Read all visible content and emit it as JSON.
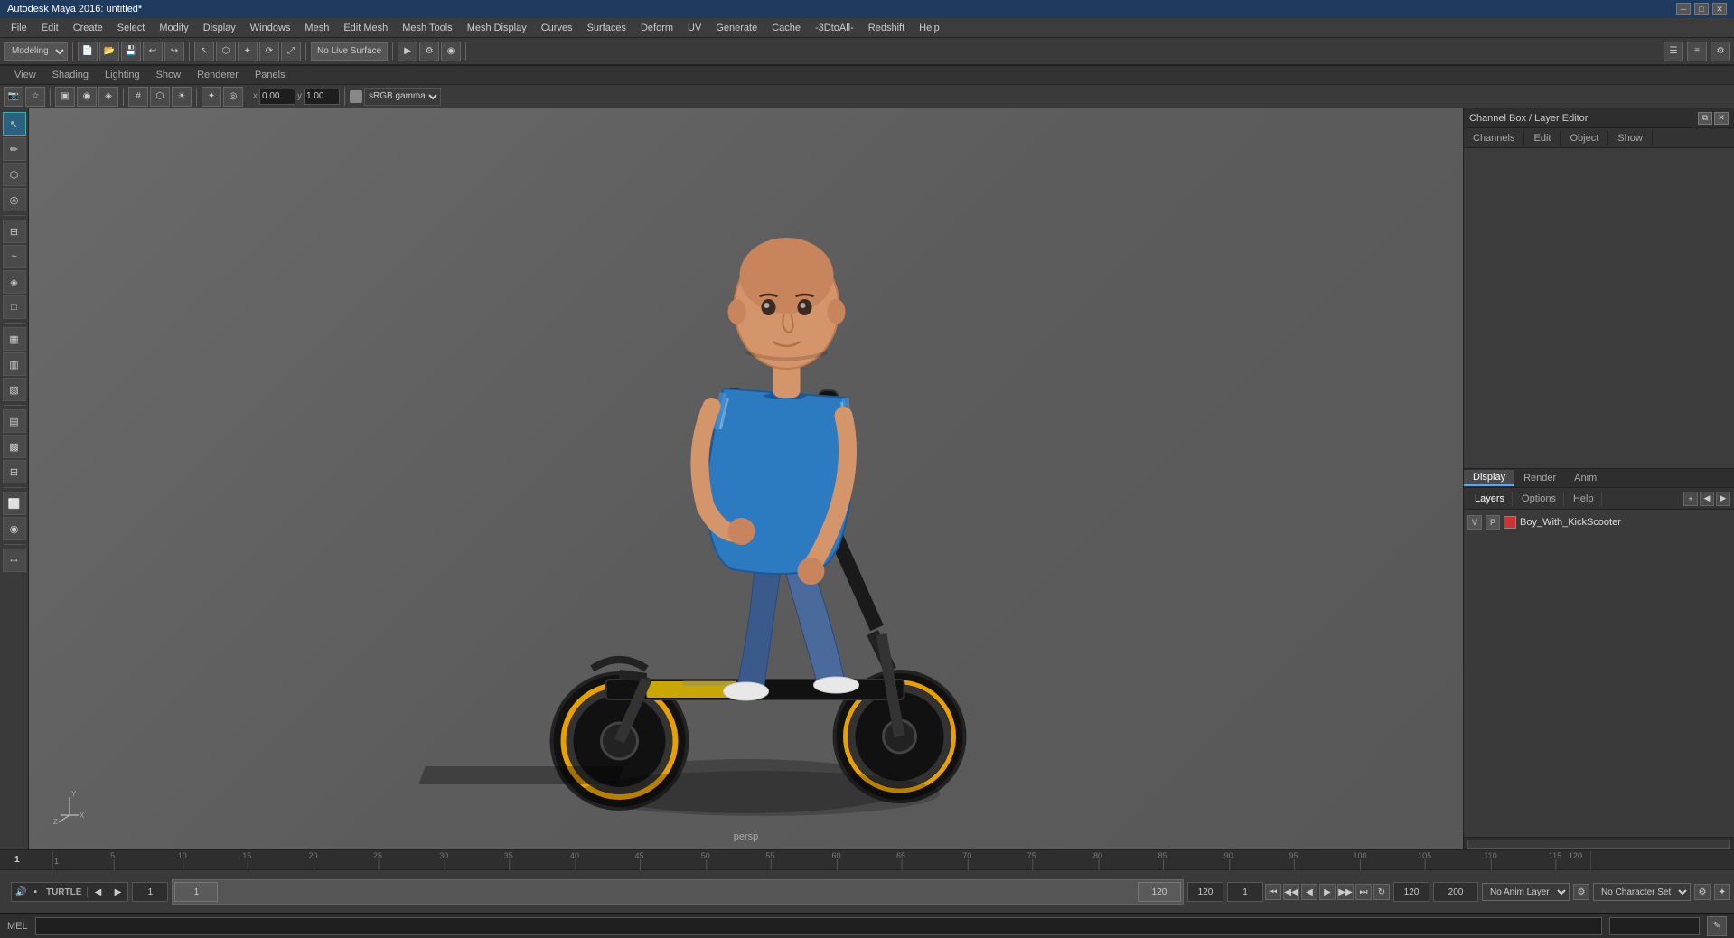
{
  "app": {
    "title": "Autodesk Maya 2016: untitled*",
    "win_buttons": [
      "─",
      "□",
      "✕"
    ]
  },
  "menu_bar": {
    "items": [
      "File",
      "Edit",
      "Create",
      "Select",
      "Modify",
      "Display",
      "Windows",
      "Mesh",
      "Edit Mesh",
      "Mesh Tools",
      "Mesh Display",
      "Curves",
      "Surfaces",
      "Deform",
      "UV",
      "Generate",
      "Cache",
      "-3DtoAll-",
      "Redshift",
      "Help"
    ]
  },
  "toolbar1": {
    "mode_label": "Modeling",
    "no_live_surface": "No Live Surface",
    "gamma_label": "sRGB gamma"
  },
  "viewport_submenu": {
    "items": [
      "View",
      "Shading",
      "Lighting",
      "Show",
      "Renderer",
      "Panels"
    ]
  },
  "toolbar2": {
    "coords": {
      "x": "0.00",
      "y": "1.00"
    }
  },
  "viewport": {
    "camera_label": "persp",
    "axis_label": "Y"
  },
  "right_panel": {
    "title": "Channel Box / Layer Editor",
    "tabs": [
      "Channels",
      "Edit",
      "Object",
      "Show"
    ]
  },
  "bottom_right": {
    "tabs": [
      "Display",
      "Render",
      "Anim"
    ],
    "active_tab": "Display",
    "layers_tabs": [
      "Layers",
      "Options",
      "Help"
    ],
    "layer_v": "V",
    "layer_p": "P",
    "layer_name": "Boy_With_KickScooter"
  },
  "timeline": {
    "ruler_ticks": [
      "1",
      "5",
      "10",
      "15",
      "20",
      "25",
      "30",
      "35",
      "40",
      "45",
      "50",
      "55",
      "60",
      "65",
      "70",
      "75",
      "80",
      "85",
      "90",
      "95",
      "100",
      "105",
      "110",
      "115",
      "120"
    ],
    "start_frame": "1",
    "current_frame": "1",
    "end_frame": "120",
    "range_start": "1",
    "range_end": "120",
    "out_frame": "200"
  },
  "playback_controls": {
    "buttons": [
      "⏮",
      "◀◀",
      "◀",
      "▶",
      "▶▶",
      "⏭"
    ]
  },
  "status_bar": {
    "mel_label": "MEL",
    "command_placeholder": ""
  },
  "anim_layer": {
    "label": "No Anim Layer",
    "character_set": "No Character Set"
  },
  "left_tools": {
    "tools": [
      "↖",
      "⟳",
      "⤢",
      "◈",
      "✦",
      "⬡",
      "◉",
      "⬜",
      "▣",
      "▦",
      "▩",
      "▤",
      "▥",
      "▧",
      "▨",
      "⊞",
      "⊟"
    ]
  }
}
